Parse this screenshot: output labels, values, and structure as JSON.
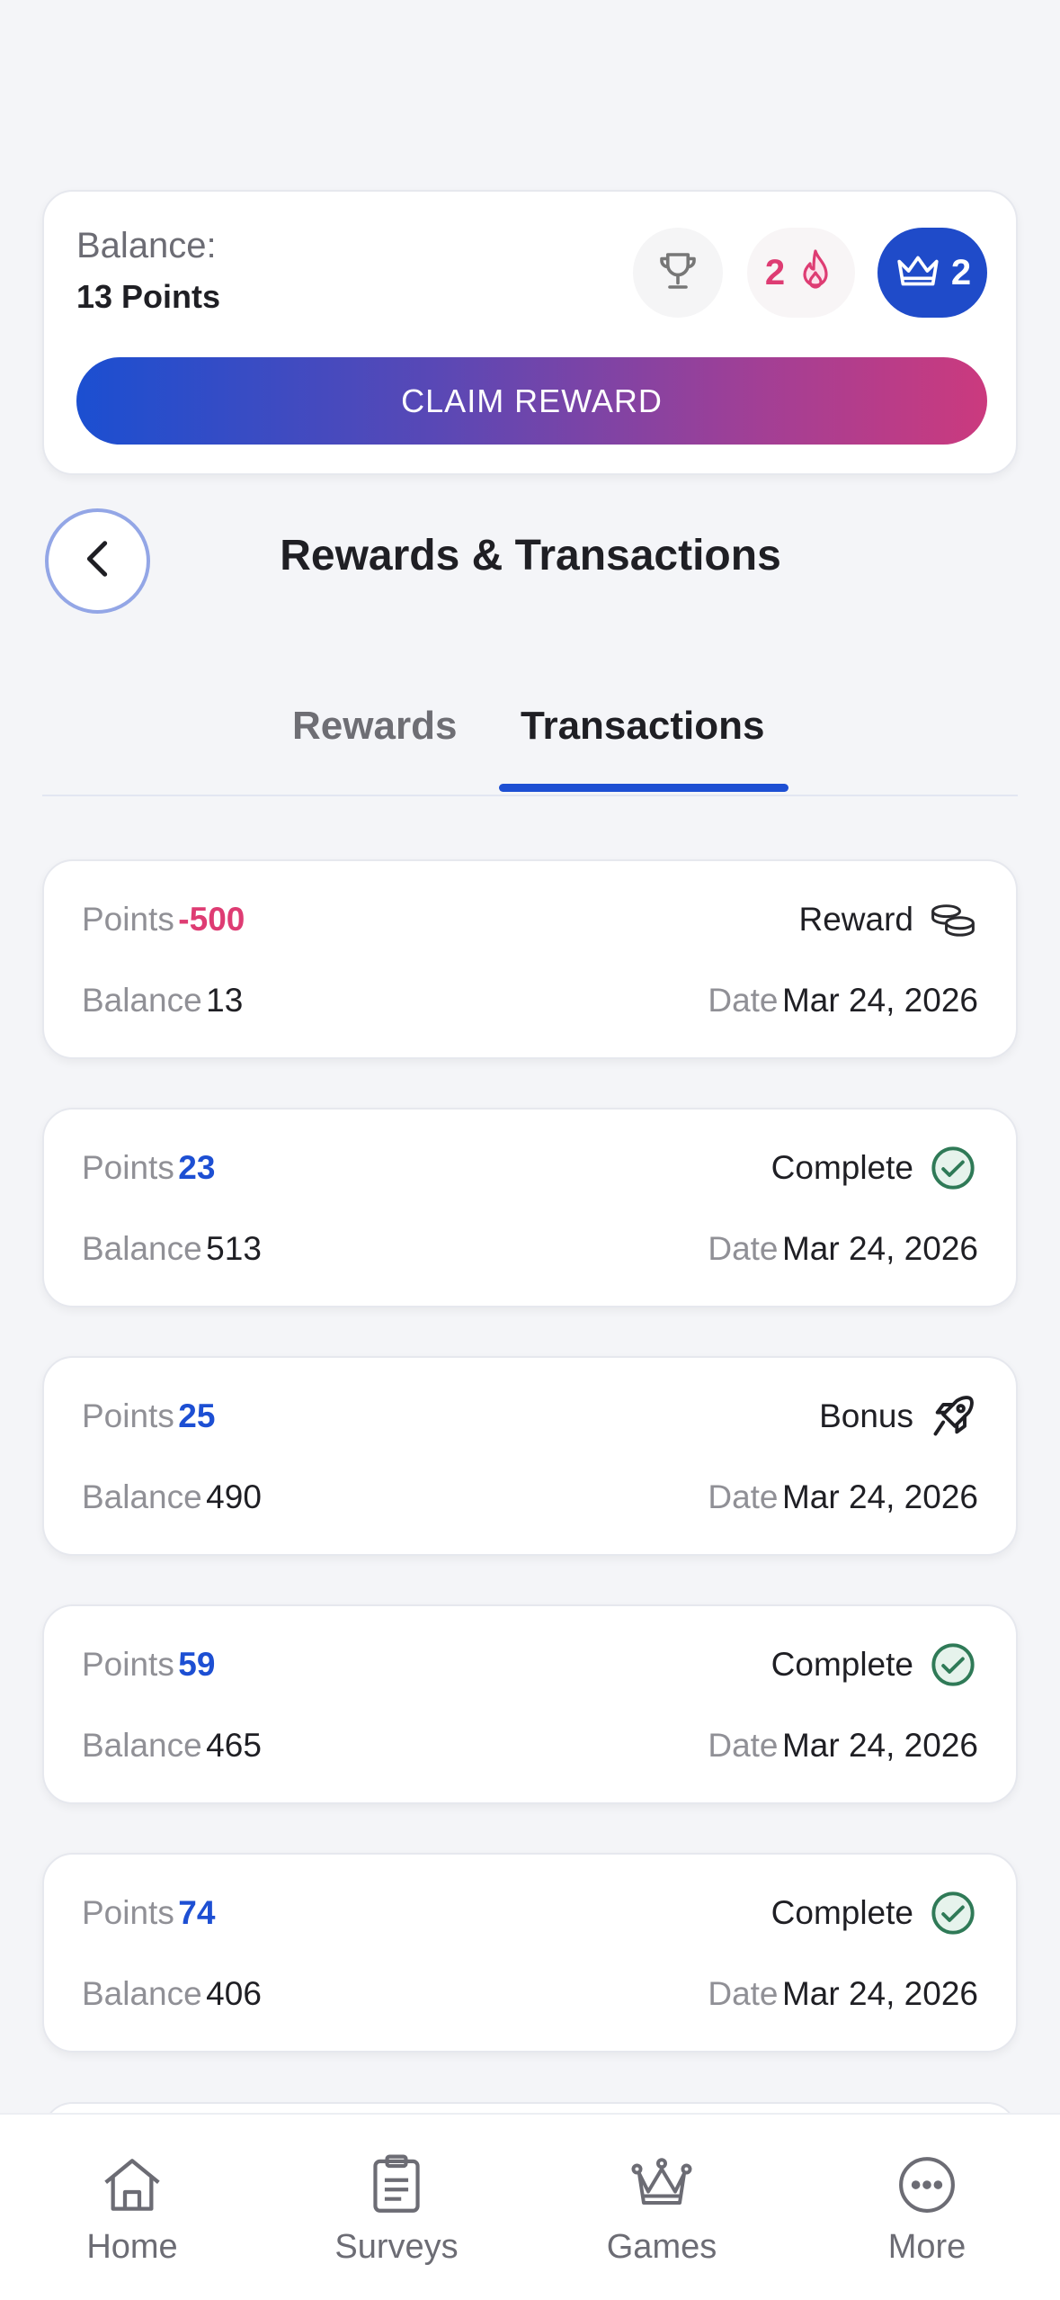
{
  "header": {
    "balance_label": "Balance:",
    "balance_value": "13 Points",
    "streak_count": "2",
    "level_count": "2",
    "claim_label": "CLAIM REWARD",
    "icons": [
      "trophy-icon",
      "flame-icon",
      "crown-icon"
    ]
  },
  "page": {
    "title": "Rewards & Transactions",
    "back_icon": "chevron-left-icon"
  },
  "tabs": [
    {
      "label": "Rewards",
      "active": false
    },
    {
      "label": "Transactions",
      "active": true
    }
  ],
  "labels": {
    "points": "Points",
    "balance": "Balance",
    "date": "Date"
  },
  "transactions": [
    {
      "points": "-500",
      "type": "Reward",
      "icon": "coins-icon",
      "balance": "13",
      "date": "Mar 24, 2026"
    },
    {
      "points": "23",
      "type": "Complete",
      "icon": "check-circle-icon",
      "balance": "513",
      "date": "Mar 24, 2026"
    },
    {
      "points": "25",
      "type": "Bonus",
      "icon": "rocket-icon",
      "balance": "490",
      "date": "Mar 24, 2026"
    },
    {
      "points": "59",
      "type": "Complete",
      "icon": "check-circle-icon",
      "balance": "465",
      "date": "Mar 24, 2026"
    },
    {
      "points": "74",
      "type": "Complete",
      "icon": "check-circle-icon",
      "balance": "406",
      "date": "Mar 24, 2026"
    }
  ],
  "nav": [
    {
      "label": "Home",
      "icon": "home-icon"
    },
    {
      "label": "Surveys",
      "icon": "clipboard-icon"
    },
    {
      "label": "Games",
      "icon": "crown-icon"
    },
    {
      "label": "More",
      "icon": "more-icon"
    }
  ],
  "colors": {
    "accent_blue": "#1d4fd3",
    "negative_pink": "#de3c73",
    "success_green": "#2f7a57",
    "gradient": [
      "#1b4fd1",
      "#cb3a7e"
    ]
  }
}
